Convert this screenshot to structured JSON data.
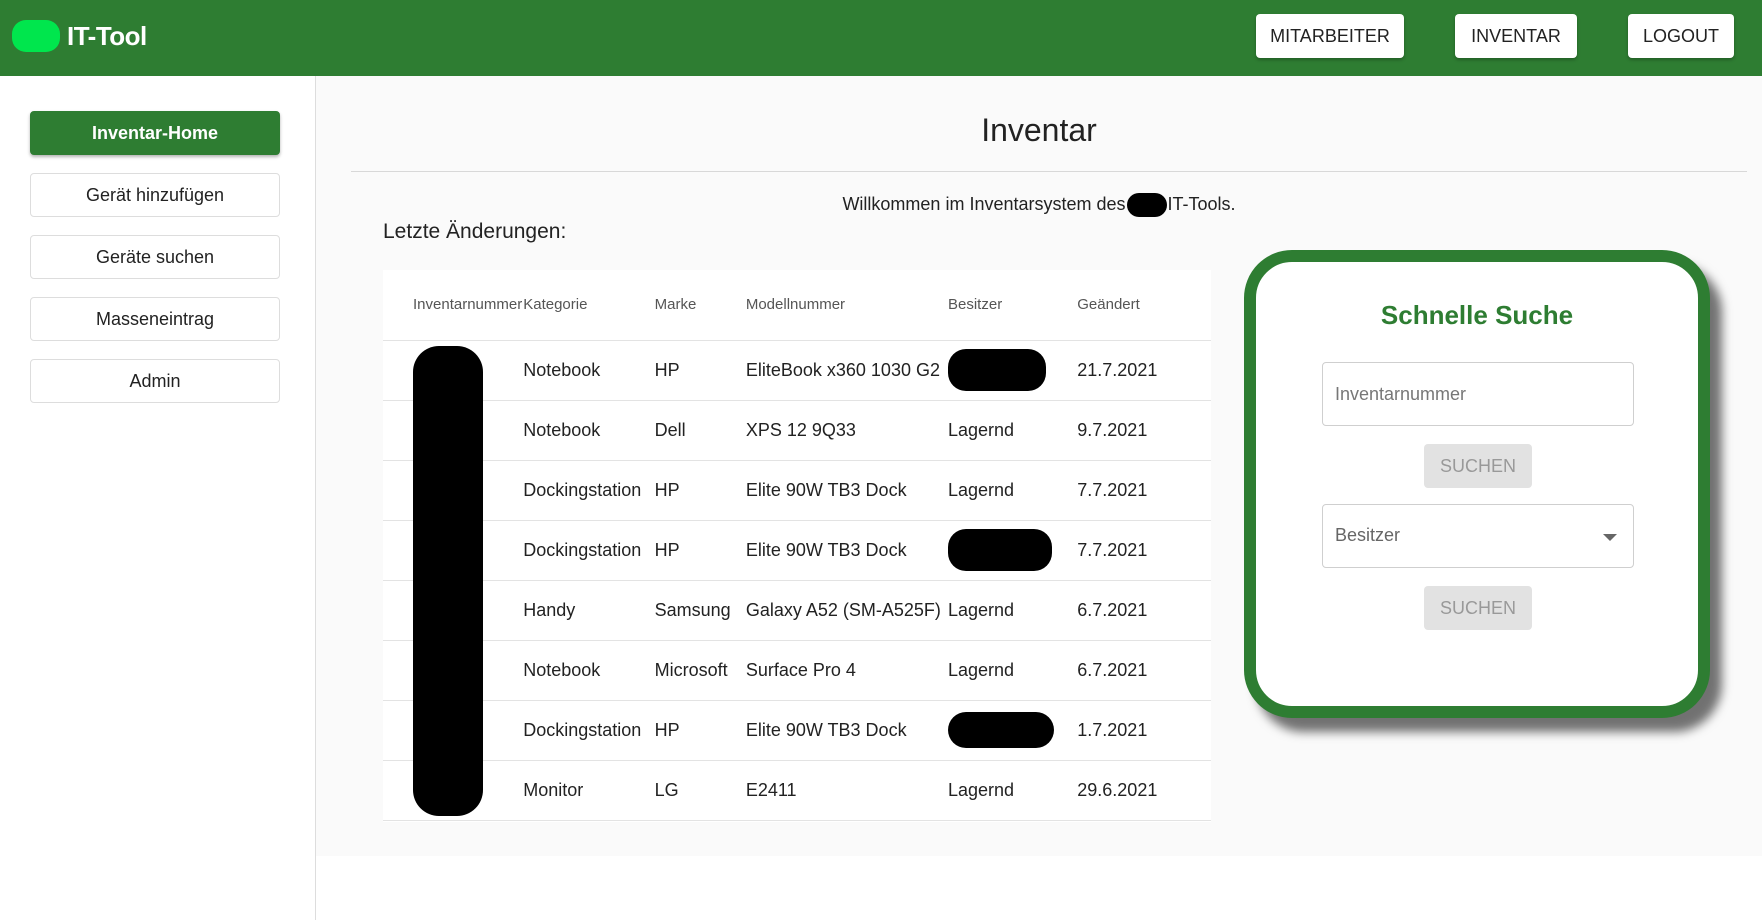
{
  "header": {
    "app_title": "IT-Tool",
    "nav": {
      "employees": "MITARBEITER",
      "inventory": "INVENTAR",
      "logout": "LOGOUT"
    }
  },
  "sidebar": {
    "items": [
      {
        "label": "Inventar-Home",
        "active": true
      },
      {
        "label": "Gerät hinzufügen"
      },
      {
        "label": "Geräte suchen"
      },
      {
        "label": "Masseneintrag"
      },
      {
        "label": "Admin"
      }
    ]
  },
  "main": {
    "title": "Inventar",
    "welcome_before": "Willkommen im Inventarsystem des",
    "welcome_after": "IT-Tools.",
    "recent_label": "Letzte Änderungen:"
  },
  "table": {
    "headers": [
      "Inventarnummer",
      "Kategorie",
      "Marke",
      "Modellnummer",
      "Besitzer",
      "Geändert"
    ],
    "rows": [
      {
        "kategorie": "Notebook",
        "marke": "HP",
        "modell": "EliteBook x360 1030 G2",
        "besitzer": "",
        "besitzer_redacted": true,
        "geaendert": "21.7.2021"
      },
      {
        "kategorie": "Notebook",
        "marke": "Dell",
        "modell": "XPS 12 9Q33",
        "besitzer": "Lagernd",
        "geaendert": "9.7.2021"
      },
      {
        "kategorie": "Dockingstation",
        "marke": "HP",
        "modell": "Elite 90W TB3 Dock",
        "besitzer": "Lagernd",
        "geaendert": "7.7.2021"
      },
      {
        "kategorie": "Dockingstation",
        "marke": "HP",
        "modell": "Elite 90W TB3 Dock",
        "besitzer": "",
        "besitzer_redacted": true,
        "geaendert": "7.7.2021"
      },
      {
        "kategorie": "Handy",
        "marke": "Samsung",
        "modell": "Galaxy A52 (SM-A525F)",
        "besitzer": "Lagernd",
        "geaendert": "6.7.2021"
      },
      {
        "kategorie": "Notebook",
        "marke": "Microsoft",
        "modell": "Surface Pro 4",
        "besitzer": "Lagernd",
        "geaendert": "6.7.2021"
      },
      {
        "kategorie": "Dockingstation",
        "marke": "HP",
        "modell": "Elite 90W TB3 Dock",
        "besitzer": "",
        "besitzer_redacted": true,
        "geaendert": "1.7.2021"
      },
      {
        "kategorie": "Monitor",
        "marke": "LG",
        "modell": "E2411",
        "besitzer": "Lagernd",
        "geaendert": "29.6.2021"
      }
    ]
  },
  "quick_search": {
    "title": "Schnelle Suche",
    "inventory_placeholder": "Inventarnummer",
    "search_label_1": "SUCHEN",
    "owner_select": "Besitzer",
    "search_label_2": "SUCHEN"
  },
  "colors": {
    "brand_green": "#2e7d32",
    "logo_green": "#00e64d"
  }
}
